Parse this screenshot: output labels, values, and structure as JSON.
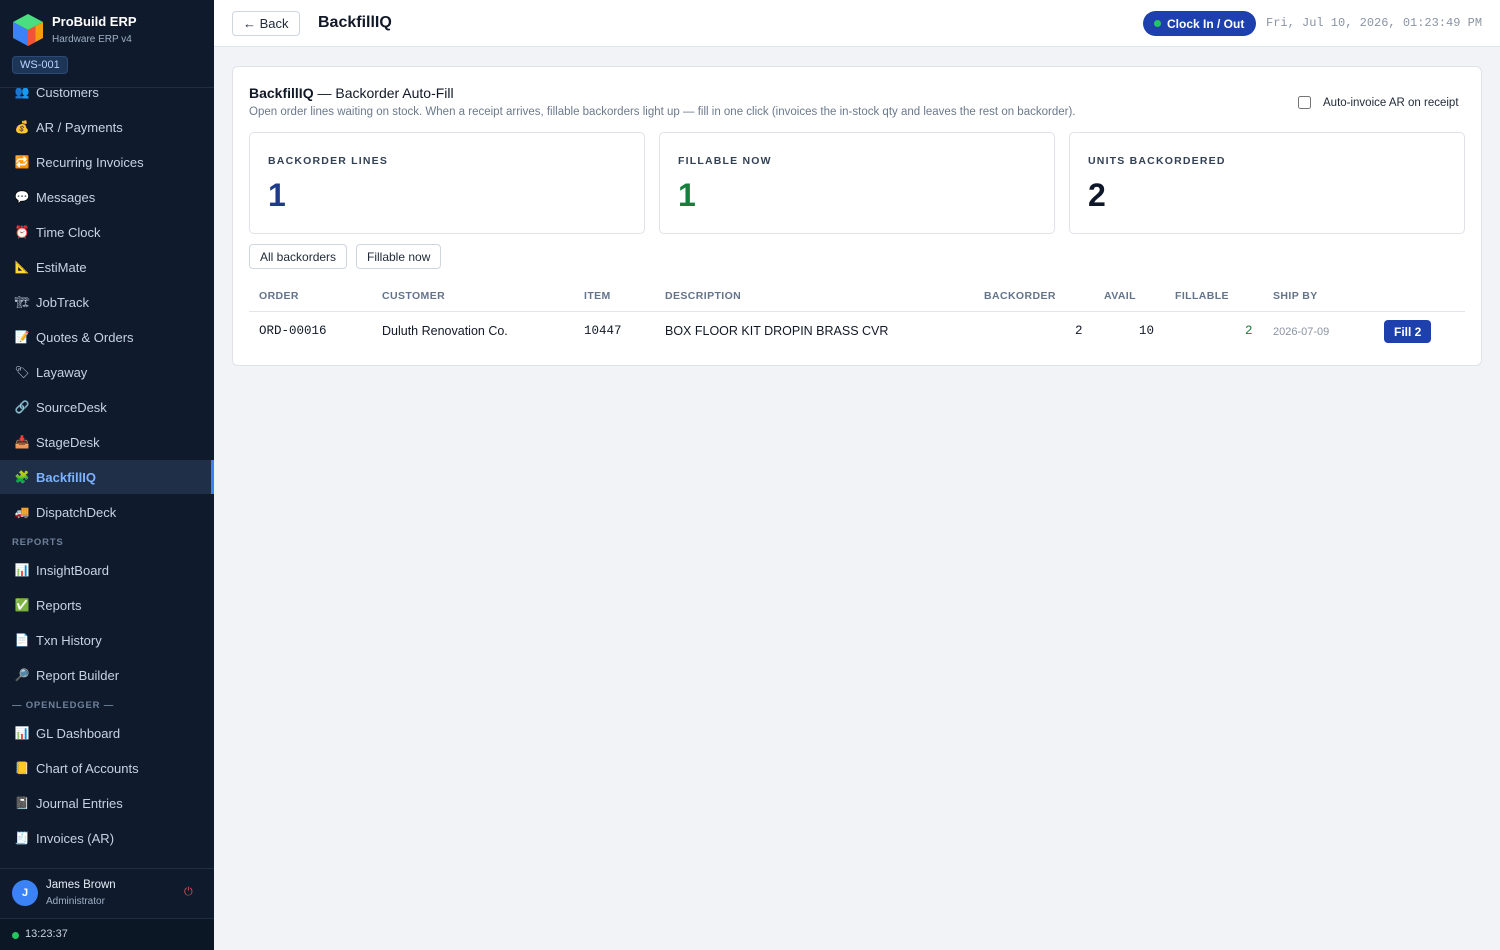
{
  "brand": {
    "name": "ProBuild ERP",
    "subtitle": "Hardware ERP v4",
    "workstation": "WS-001"
  },
  "sidebar": {
    "items": [
      {
        "label": "Customers",
        "icon": "users-icon"
      },
      {
        "label": "AR / Payments",
        "icon": "money-bag-icon"
      },
      {
        "label": "Recurring Invoices",
        "icon": "repeat-icon"
      },
      {
        "label": "Messages",
        "icon": "speech-bubble-icon"
      },
      {
        "label": "Time Clock",
        "icon": "alarm-clock-icon"
      },
      {
        "label": "EstiMate",
        "icon": "triangle-ruler-icon"
      },
      {
        "label": "JobTrack",
        "icon": "construction-icon"
      },
      {
        "label": "Quotes & Orders",
        "icon": "memo-icon"
      },
      {
        "label": "Layaway",
        "icon": "tag-icon"
      },
      {
        "label": "SourceDesk",
        "icon": "link-icon"
      },
      {
        "label": "StageDesk",
        "icon": "inbox-tray-icon"
      },
      {
        "label": "BackfillIQ",
        "icon": "puzzle-icon",
        "active": true
      },
      {
        "label": "DispatchDeck",
        "icon": "truck-icon"
      }
    ],
    "section_reports": "REPORTS",
    "report_items": [
      {
        "label": "InsightBoard",
        "icon": "bar-chart-icon"
      },
      {
        "label": "Reports",
        "icon": "check-box-icon"
      },
      {
        "label": "Txn History",
        "icon": "document-icon"
      },
      {
        "label": "Report Builder",
        "icon": "magnifier-icon"
      }
    ],
    "section_ledger": "— OPENLEDGER —",
    "ledger_items": [
      {
        "label": "GL Dashboard",
        "icon": "bar-chart-icon"
      },
      {
        "label": "Chart of Accounts",
        "icon": "ledger-icon"
      },
      {
        "label": "Journal Entries",
        "icon": "notebook-icon"
      },
      {
        "label": "Invoices (AR)",
        "icon": "receipt-icon"
      }
    ]
  },
  "user": {
    "initial": "J",
    "name": "James Brown",
    "role": "Administrator",
    "clock": "13:23:37"
  },
  "header": {
    "back_label": "← Back",
    "title": "BackfillIQ",
    "clock_btn": "Clock In / Out",
    "datetime": "Fri, Jul 10, 2026, 01:23:49 PM"
  },
  "panel": {
    "title_bold": "BackfillIQ",
    "title_rest": " — Backorder Auto-Fill",
    "description": "Open order lines waiting on stock. When a receipt arrives, fillable backorders light up — fill in one click (invoices the in-stock qty and leaves the rest on backorder).",
    "auto_invoice_label": "Auto-invoice AR on receipt",
    "stats": [
      {
        "label": "BACKORDER LINES",
        "value": "1",
        "color": "#1e3a8a"
      },
      {
        "label": "FILLABLE NOW",
        "value": "1",
        "color": "#15803d"
      },
      {
        "label": "UNITS BACKORDERED",
        "value": "2",
        "color": "#0f172a"
      }
    ],
    "filters": [
      "All backorders",
      "Fillable now"
    ]
  },
  "table": {
    "headers": [
      "ORDER",
      "CUSTOMER",
      "ITEM",
      "DESCRIPTION",
      "BACKORDER",
      "AVAIL",
      "FILLABLE",
      "SHIP BY"
    ],
    "rows": [
      {
        "order": "ORD-00016",
        "customer": "Duluth Renovation Co.",
        "item": "10447",
        "description": "BOX FLOOR KIT DROPIN BRASS CVR",
        "backorder": "2",
        "avail": "10",
        "fillable": "2",
        "ship_by": "2026-07-09",
        "action": "Fill 2"
      }
    ]
  }
}
